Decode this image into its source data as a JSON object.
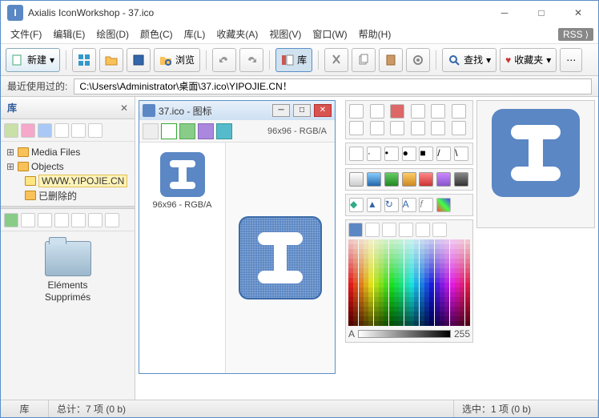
{
  "window": {
    "title": "Axialis IconWorkshop - 37.ico"
  },
  "menu": [
    "文件(F)",
    "编辑(E)",
    "绘图(D)",
    "颜色(C)",
    "库(L)",
    "收藏夹(A)",
    "视图(V)",
    "窗口(W)",
    "帮助(H)"
  ],
  "rss": "RSS",
  "toolbar": {
    "new": "新建",
    "browse": "浏览",
    "lib": "库",
    "search": "查找",
    "fav": "收藏夹"
  },
  "pathbar": {
    "label": "最近使用过的:",
    "value": "C:\\Users\\Administrator\\桌面\\37.ico\\YIPOJIE.CN！"
  },
  "sidebar": {
    "title": "库",
    "tree": [
      {
        "label": "Media Files",
        "expandable": true
      },
      {
        "label": "Objects",
        "expandable": true
      },
      {
        "label": "WWW.YIPOJIE.CN",
        "selected": true
      },
      {
        "label": "已删除的",
        "expandable": false
      }
    ],
    "folder": {
      "line1": "Eléments",
      "line2": "Supprimés"
    }
  },
  "doc": {
    "title": "37.ico - 图标",
    "info": "96x96 - RGB/A",
    "format_label": "96x96 - RGB/A"
  },
  "alpha": {
    "label": "A",
    "value": "255"
  },
  "status": {
    "lib": "库",
    "total": "总计：7 项 (0 b)",
    "selected": "选中：1 项 (0 b)"
  }
}
